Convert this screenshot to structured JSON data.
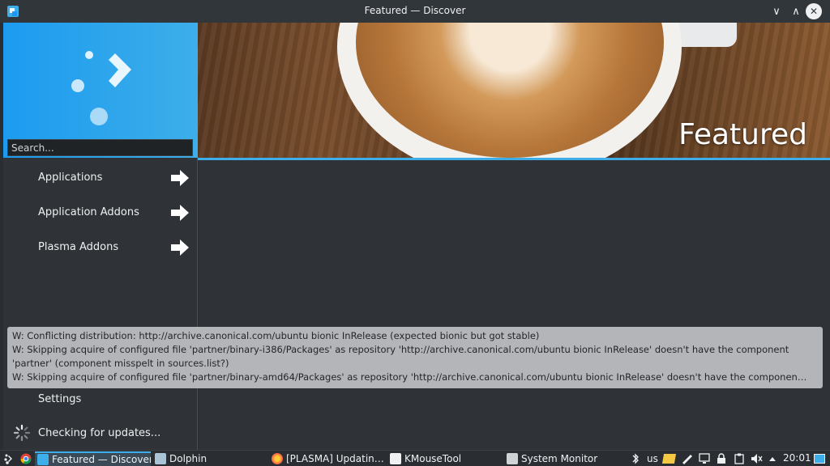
{
  "window": {
    "title": "Featured — Discover",
    "controls": {
      "minimize": "∨",
      "maximize": "∧",
      "close": "✕"
    }
  },
  "sidebar": {
    "search_placeholder": "Search...",
    "items": [
      {
        "label": "Applications",
        "icon": "arrow-right-icon"
      },
      {
        "label": "Application Addons",
        "icon": "arrow-right-icon"
      },
      {
        "label": "Plasma Addons",
        "icon": "arrow-right-icon"
      }
    ],
    "settings_label": "Settings",
    "status_label": "Checking for updates..."
  },
  "header": {
    "title": "Featured"
  },
  "notification": {
    "lines": [
      "W: Conflicting distribution: http://archive.canonical.com/ubuntu bionic InRelease (expected bionic but got stable)",
      "W: Skipping acquire of configured file 'partner/binary-i386/Packages' as repository 'http://archive.canonical.com/ubuntu bionic InRelease' doesn't have the component",
      "'partner' (component misspelt in sources.list?)",
      "W: Skipping acquire of configured file 'partner/binary-amd64/Packages' as repository 'http://archive.canonical.com/ubuntu bionic InRelease' doesn't have the componen…"
    ]
  },
  "taskbar": {
    "tasks": [
      {
        "label": "Featured — Discover",
        "active": true
      },
      {
        "label": "Dolphin",
        "active": false
      },
      {
        "label": "[PLASMA] Updatin…",
        "active": false
      },
      {
        "label": "KMouseTool",
        "active": false
      },
      {
        "label": "System Monitor",
        "active": false
      }
    ],
    "keyboard_layout": "us",
    "clock": "20:01"
  },
  "colors": {
    "accent": "#3daee9",
    "window_bg": "#2f3337",
    "titlebar_bg": "#31363b"
  }
}
